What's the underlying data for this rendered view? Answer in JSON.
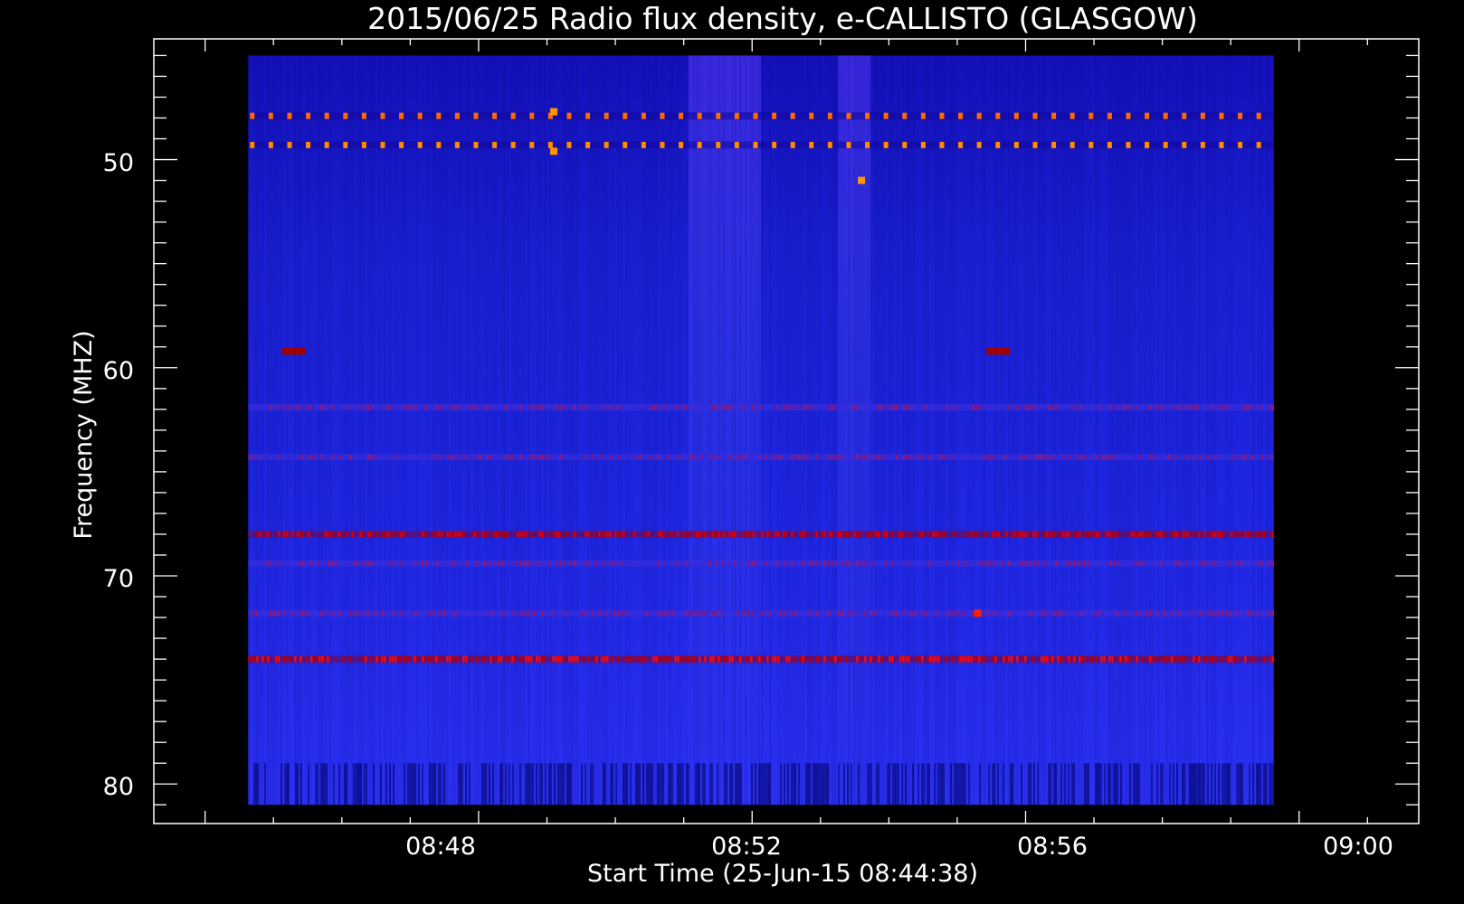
{
  "chart_data": {
    "type": "heatmap",
    "title": "2015/06/25  Radio flux density, e-CALLISTO (GLASGOW)",
    "xlabel": "Start Time (25-Jun-15 08:44:38)",
    "ylabel": "Frequency (MHZ)",
    "x_ticks": [
      "08:48",
      "08:52",
      "08:56",
      "09:00"
    ],
    "y_ticks": [
      "50",
      "60",
      "70",
      "80"
    ],
    "xlim_minutes_after_0844": [
      -0.75,
      17.75
    ],
    "data_x_minutes_after_0844": [
      0.63,
      15.63
    ],
    "ylim_mhz": [
      44.2,
      81.9
    ],
    "data_y_mhz": [
      45.0,
      81.0
    ],
    "colormap": [
      "#00008c",
      "#1e1ef0",
      "#3c46ff",
      "#b40000",
      "#ff1e00",
      "#ff9600"
    ],
    "background_level": "blue",
    "bands": [
      {
        "freq_mhz": 47.9,
        "pattern": "dashed",
        "color": "#ff6a00"
      },
      {
        "freq_mhz": 49.3,
        "pattern": "dashed",
        "color": "#ff8c00"
      },
      {
        "freq_mhz": 61.9,
        "pattern": "faint",
        "color": "#a01060"
      },
      {
        "freq_mhz": 64.3,
        "pattern": "faint",
        "color": "#a01060"
      },
      {
        "freq_mhz": 68.0,
        "pattern": "speckled",
        "color": "#e00000"
      },
      {
        "freq_mhz": 69.4,
        "pattern": "faint",
        "color": "#a01060"
      },
      {
        "freq_mhz": 71.8,
        "pattern": "faint",
        "color": "#a01060"
      },
      {
        "freq_mhz": 74.0,
        "pattern": "speckled",
        "color": "#ff0a00"
      }
    ],
    "spots": [
      {
        "t_min": 5.1,
        "freq_mhz": 47.7,
        "color": "#ff9600"
      },
      {
        "t_min": 5.1,
        "freq_mhz": 49.6,
        "color": "#ff9600"
      },
      {
        "t_min": 9.6,
        "freq_mhz": 51.0,
        "color": "#ff9600"
      },
      {
        "t_min": 1.3,
        "freq_mhz": 59.2,
        "color": "#a00000"
      },
      {
        "t_min": 11.6,
        "freq_mhz": 59.2,
        "color": "#a00000"
      },
      {
        "t_min": 11.3,
        "freq_mhz": 71.8,
        "color": "#ff2000"
      }
    ],
    "vertical_brightening_min": [
      9.5,
      7.6
    ]
  }
}
